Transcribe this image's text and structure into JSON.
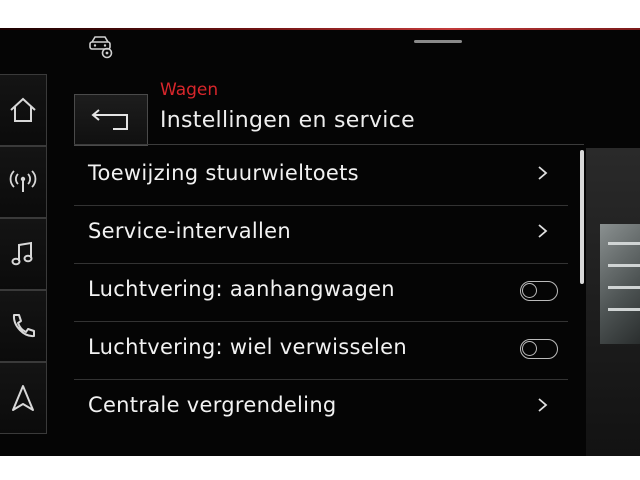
{
  "header": {
    "breadcrumb": "Wagen",
    "title": "Instellingen en service"
  },
  "sidebar": {
    "items": [
      {
        "icon": "home-icon"
      },
      {
        "icon": "radio-icon"
      },
      {
        "icon": "music-icon"
      },
      {
        "icon": "phone-icon"
      },
      {
        "icon": "navigation-icon"
      }
    ]
  },
  "status": {
    "icon": "car-settings-icon"
  },
  "list": {
    "items": [
      {
        "label": "Toewijzing stuurwieltoets",
        "control": "chevron"
      },
      {
        "label": "Service-intervallen",
        "control": "chevron"
      },
      {
        "label": "Luchtvering: aanhangwagen",
        "control": "toggle",
        "state": "off"
      },
      {
        "label": "Luchtvering: wiel verwisselen",
        "control": "toggle",
        "state": "off"
      },
      {
        "label": "Centrale vergrendeling",
        "control": "chevron"
      }
    ]
  },
  "colors": {
    "accent": "#d8262b",
    "background": "#050505",
    "text": "#f2f2f2"
  }
}
